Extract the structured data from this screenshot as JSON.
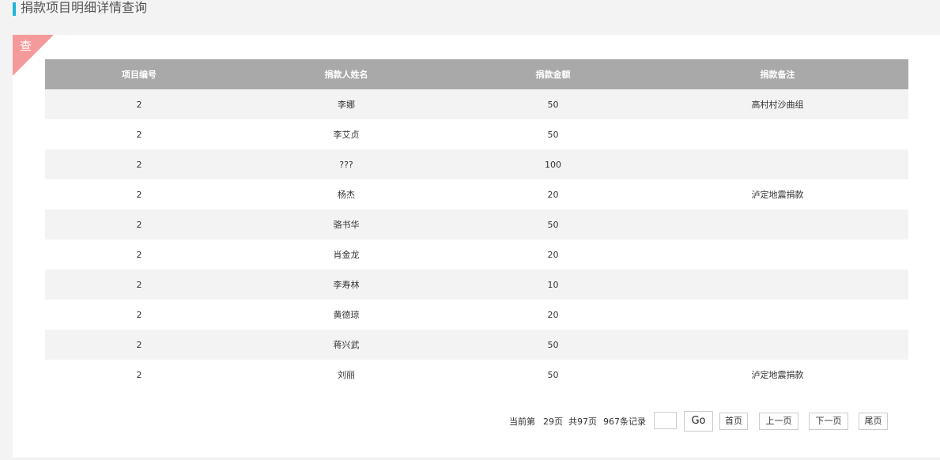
{
  "page": {
    "title": "捐款项目明细详情查询"
  },
  "badge": {
    "label": "查"
  },
  "colors": {
    "accent": "#1fb6d6",
    "badge": "#f59a9a",
    "table_header": "#a9a9a9",
    "row_stripe": "#f3f3f3"
  },
  "table": {
    "columns": [
      "项目编号",
      "捐款人姓名",
      "捐款金额",
      "捐款备注"
    ],
    "rows": [
      [
        "2",
        "李娜",
        "50",
        "高村村沙曲组"
      ],
      [
        "2",
        "李艾贞",
        "50",
        ""
      ],
      [
        "2",
        "???",
        "100",
        ""
      ],
      [
        "2",
        "杨杰",
        "20",
        "泸定地震捐款"
      ],
      [
        "2",
        "骆书华",
        "50",
        ""
      ],
      [
        "2",
        "肖金龙",
        "20",
        ""
      ],
      [
        "2",
        "李寿林",
        "10",
        ""
      ],
      [
        "2",
        "黄德琼",
        "20",
        ""
      ],
      [
        "2",
        "蒋兴武",
        "50",
        ""
      ],
      [
        "2",
        "刘丽",
        "50",
        "泸定地震捐款"
      ]
    ]
  },
  "pagination": {
    "current_text": "当前第",
    "current_page": "29页",
    "total_pages": "共97页",
    "total_records": "967条记录",
    "jump_value": "",
    "go_label": "Go",
    "first_label": "首页",
    "prev_label": "上一页",
    "next_label": "下一页",
    "last_label": "尾页"
  }
}
